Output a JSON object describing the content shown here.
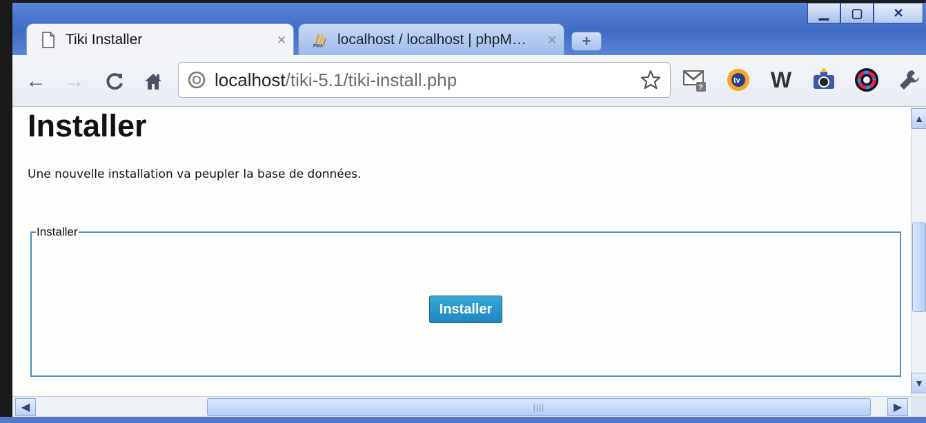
{
  "window": {
    "controls": {
      "minimize": "▁",
      "maximize": "▢",
      "close": "✕"
    }
  },
  "tabs": [
    {
      "title": "Tiki Installer",
      "icon": "page-icon",
      "active": true,
      "close": "×"
    },
    {
      "title": "localhost / localhost | phpM…",
      "icon": "phpmyadmin-icon",
      "active": false,
      "close": "×"
    }
  ],
  "new_tab": "+",
  "toolbar": {
    "back": "←",
    "forward": "→",
    "reload": "C",
    "home": "⌂",
    "url_host": "localhost",
    "url_path": "/tiki-5.1/tiki-install.php",
    "extensions": [
      "gmail-checker-icon",
      "tv-icon",
      "w-icon",
      "camera-icon",
      "color-wheel-icon",
      "wrench-icon"
    ],
    "ext_w": "W"
  },
  "page": {
    "title": "Installer",
    "description": "Une nouvelle installation va peupler la base de données.",
    "fieldset_legend": "Installer",
    "install_button": "Installer"
  },
  "scrollbars": {
    "up": "▲",
    "down": "▼",
    "left": "◀",
    "right": "▶",
    "grip": "||||",
    "vgrip": "≡"
  },
  "colors": {
    "frame_blue": "#3f6cc4",
    "fieldset_border": "#4a8fc1",
    "install_button": "#1e88c0"
  }
}
